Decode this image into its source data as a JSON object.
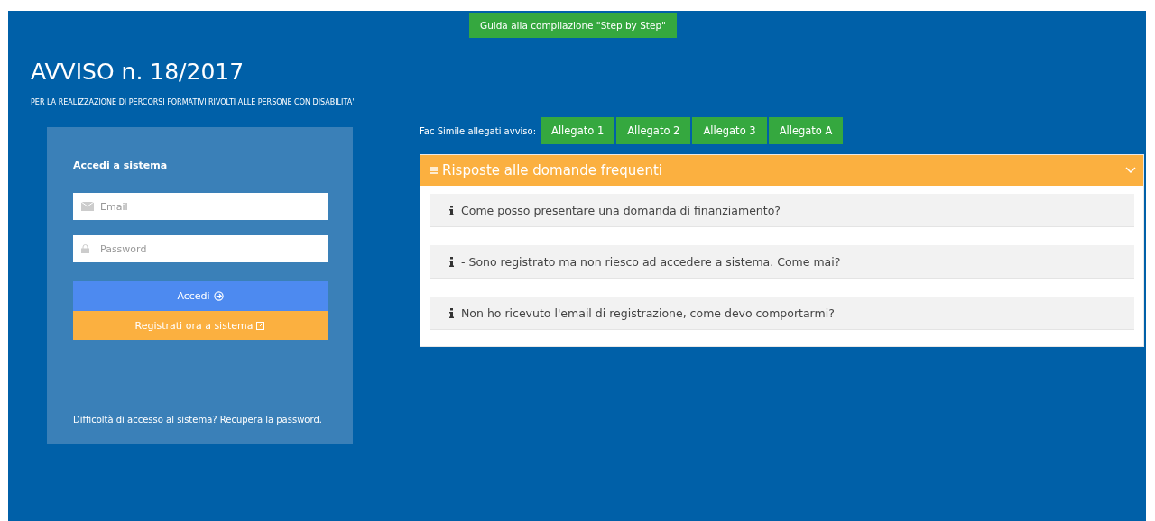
{
  "guide_button": "Guida alla compilazione \"Step by Step\"",
  "title": "AVVISO n. 18/2017",
  "subtitle": "PER LA REALIZZAZIONE DI PERCORSI FORMATIVI RIVOLTI ALLE PERSONE CON DISABILITA'",
  "login": {
    "heading": "Accedi a sistema",
    "fields": [
      {
        "kind": "email",
        "placeholder": "Email"
      },
      {
        "kind": "password",
        "placeholder": "Password"
      }
    ],
    "login_button": "Accedi",
    "register_button": "Registrati ora a sistema",
    "help": "Difficoltà di accesso al sistema? Recupera la password."
  },
  "attachments": {
    "label": "Fac Simile allegati avviso:",
    "buttons": [
      "Allegato 1",
      "Allegato 2",
      "Allegato 3",
      "Allegato A"
    ]
  },
  "faq": {
    "title": "Risposte alle domande frequenti",
    "expanded": true,
    "items": [
      "Come posso presentare una domanda di finanziamento?",
      "- Sono registrato ma non riesco ad accedere a sistema. Come mai?",
      "Non ho ricevuto l'email di registrazione, come devo comportarmi?"
    ]
  }
}
